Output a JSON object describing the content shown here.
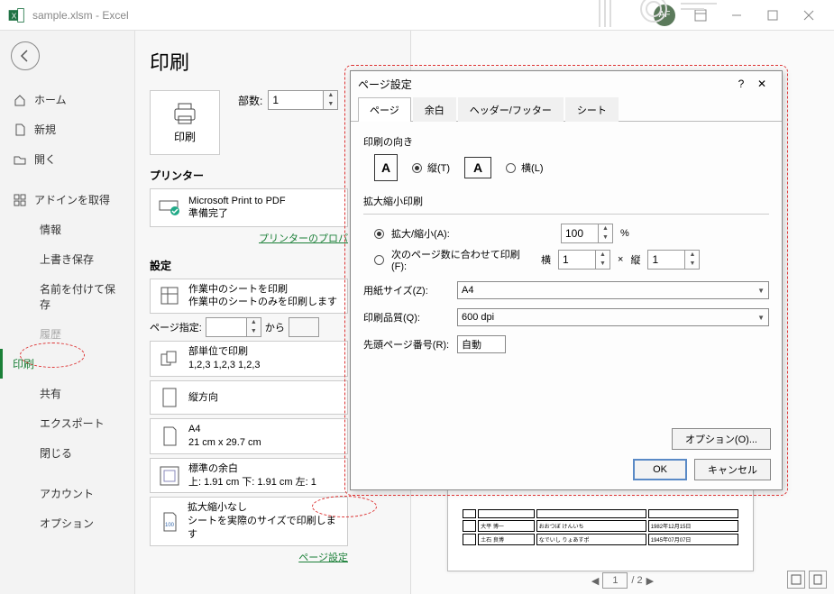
{
  "titlebar": {
    "filename": "sample.xlsm  -  Excel",
    "avatar": "AF"
  },
  "sidebar": {
    "home": "ホーム",
    "new": "新規",
    "open": "開く",
    "addin": "アドインを取得",
    "info": "情報",
    "save": "上書き保存",
    "saveas": "名前を付けて保存",
    "history": "履歴",
    "print": "印刷",
    "share": "共有",
    "export": "エクスポート",
    "close": "閉じる",
    "account": "アカウント",
    "options": "オプション"
  },
  "content": {
    "heading": "印刷",
    "copies_label": "部数:",
    "copies_value": "1",
    "print_btn": "印刷",
    "printer_label": "プリンター",
    "printer_name": "Microsoft Print to PDF",
    "printer_status": "準備完了",
    "printer_props": "プリンターのプロパ",
    "settings_label": "設定",
    "s1_title": "作業中のシートを印刷",
    "s1_sub": "作業中のシートのみを印刷します",
    "pages_label": "ページ指定:",
    "pages_to": "から",
    "s2_title": "部単位で印刷",
    "s2_sub": "1,2,3    1,2,3    1,2,3",
    "s3_title": "縦方向",
    "s4_title": "A4",
    "s4_sub": "21 cm x 29.7 cm",
    "s5_title": "標準の余白",
    "s5_sub": "上: 1.91 cm 下: 1.91 cm 左: 1",
    "s6_title": "拡大縮小なし",
    "s6_sub": "シートを実際のサイズで印刷します",
    "page_setup_link": "ページ設定"
  },
  "pager": {
    "current": "1",
    "total": "/ 2"
  },
  "dialog": {
    "title": "ページ設定",
    "tabs": {
      "page": "ページ",
      "margin": "余白",
      "hf": "ヘッダー/フッター",
      "sheet": "シート"
    },
    "orient_label": "印刷の向き",
    "orient_portrait": "縦(T)",
    "orient_landscape": "横(L)",
    "scale_label": "拡大縮小印刷",
    "scale_opt": "拡大/縮小(A):",
    "scale_value": "100",
    "scale_pct": "%",
    "fit_opt": "次のページ数に合わせて印刷(F):",
    "fit_w_label": "横",
    "fit_w": "1",
    "fit_x": "×",
    "fit_h_label": "縦",
    "fit_h": "1",
    "paper_label": "用紙サイズ(Z):",
    "paper_value": "A4",
    "quality_label": "印刷品質(Q):",
    "quality_value": "600 dpi",
    "first_label": "先頭ページ番号(R):",
    "first_value": "自動",
    "options_btn": "オプション(O)...",
    "ok": "OK",
    "cancel": "キャンセル"
  },
  "chart_data": null
}
